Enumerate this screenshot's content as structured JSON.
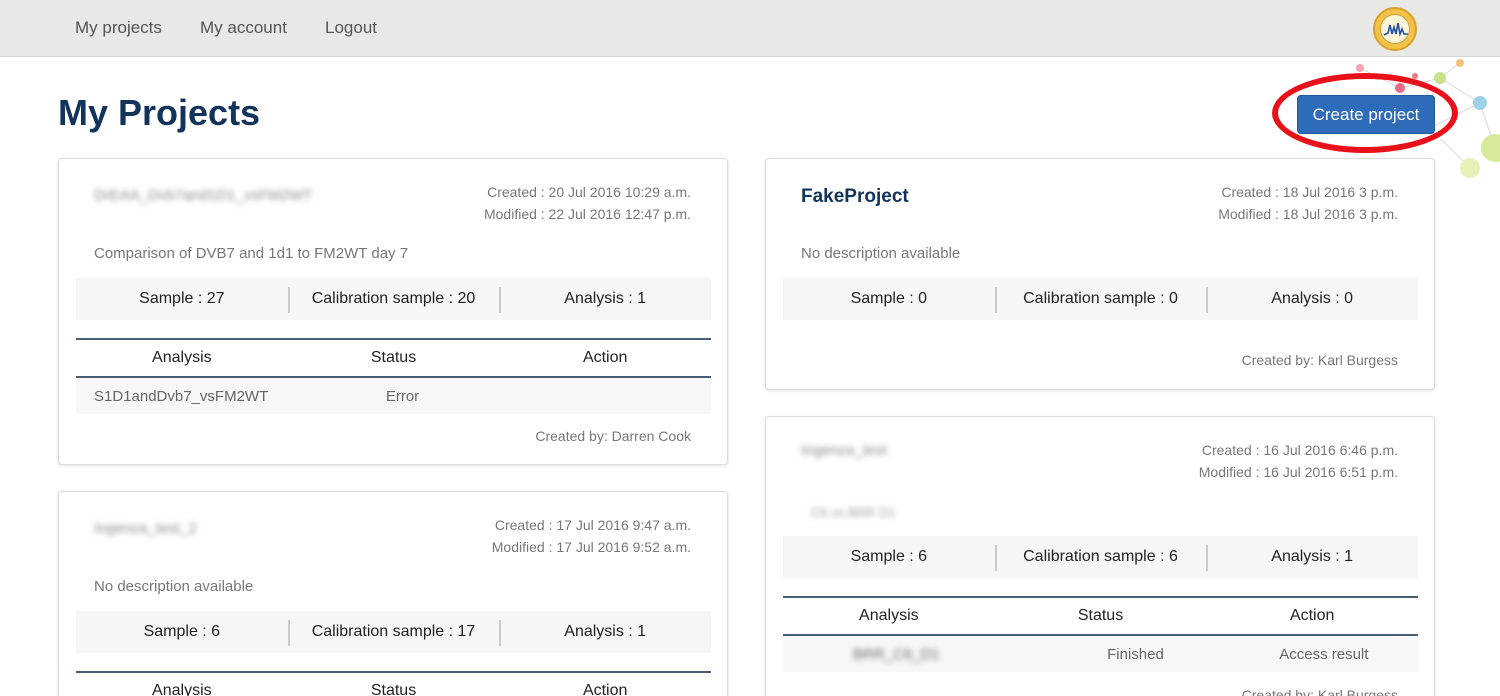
{
  "nav": {
    "items": [
      "My projects",
      "My account",
      "Logout"
    ]
  },
  "page": {
    "title": "My Projects",
    "create_button": "Create project"
  },
  "projects": [
    {
      "name": "DrEAA_Dvb7and1D1_vsFM2WT",
      "created": "Created : 20 Jul 2016 10:29 a.m.",
      "modified": "Modified : 22 Jul 2016 12:47 p.m.",
      "description": "Comparison of DVB7 and 1d1 to FM2WT day 7",
      "sample": "Sample : 27",
      "calibration": "Calibration sample : 20",
      "analysis": "Analysis : 1",
      "table_headers": [
        "Analysis",
        "Status",
        "Action"
      ],
      "rows": [
        {
          "name": "S1D1andDvb7_vsFM2WT",
          "status": "Error",
          "action": ""
        }
      ],
      "created_by": "Created by: Darren Cook"
    },
    {
      "name": "FakeProject",
      "created": "Created : 18 Jul 2016 3 p.m.",
      "modified": "Modified : 18 Jul 2016 3 p.m.",
      "description": "No description available",
      "sample": "Sample : 0",
      "calibration": "Calibration sample : 0",
      "analysis": "Analysis : 0",
      "created_by": "Created by: Karl Burgess"
    },
    {
      "name": "Ingenza_test_2",
      "created": "Created : 17 Jul 2016 9:47 a.m.",
      "modified": "Modified : 17 Jul 2016 9:52 a.m.",
      "description": "No description available",
      "sample": "Sample : 6",
      "calibration": "Calibration sample : 17",
      "analysis": "Analysis : 1",
      "table_headers": [
        "Analysis",
        "Status",
        "Action"
      ]
    },
    {
      "name": "Ingenza_test",
      "created": "Created : 16 Jul 2016 6:46 p.m.",
      "modified": "Modified : 16 Jul 2016 6:51 p.m.",
      "description": "C6 vs BRR D1",
      "sample": "Sample : 6",
      "calibration": "Calibration sample : 6",
      "analysis": "Analysis : 1",
      "table_headers": [
        "Analysis",
        "Status",
        "Action"
      ],
      "rows": [
        {
          "name": "BRR_C6_D1",
          "status": "Finished",
          "action": "Access result"
        }
      ],
      "created_by": "Created by: Karl Burgess"
    }
  ]
}
